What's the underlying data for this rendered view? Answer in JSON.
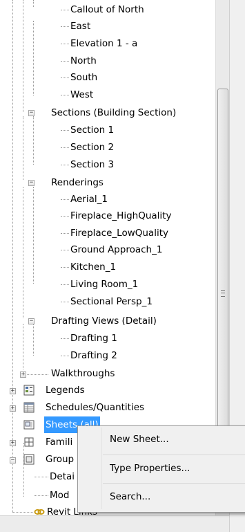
{
  "browser": {
    "items": [
      {
        "label": "Callout of North",
        "type": "leaf"
      },
      {
        "label": "East",
        "type": "leaf"
      },
      {
        "label": "Elevation 1 - a",
        "type": "leaf"
      },
      {
        "label": "North",
        "type": "leaf"
      },
      {
        "label": "South",
        "type": "leaf"
      },
      {
        "label": "West",
        "type": "leaf"
      },
      {
        "label": "Sections (Building Section)",
        "type": "group",
        "expanded": true
      },
      {
        "label": "Section 1",
        "type": "leaf"
      },
      {
        "label": "Section 2",
        "type": "leaf"
      },
      {
        "label": "Section 3",
        "type": "leaf"
      },
      {
        "label": "Renderings",
        "type": "group",
        "expanded": true
      },
      {
        "label": "Aerial_1",
        "type": "leaf"
      },
      {
        "label": "Fireplace_HighQuality",
        "type": "leaf"
      },
      {
        "label": "Fireplace_LowQuality",
        "type": "leaf"
      },
      {
        "label": "Ground Approach_1",
        "type": "leaf"
      },
      {
        "label": "Kitchen_1",
        "type": "leaf"
      },
      {
        "label": "Living Room_1",
        "type": "leaf"
      },
      {
        "label": "Sectional Persp_1",
        "type": "leaf"
      },
      {
        "label": "Drafting Views (Detail)",
        "type": "group",
        "expanded": true
      },
      {
        "label": "Drafting 1",
        "type": "leaf"
      },
      {
        "label": "Drafting 2",
        "type": "leaf"
      },
      {
        "label": "Walkthroughs",
        "type": "group",
        "expanded": false
      },
      {
        "label": "Legends",
        "type": "root",
        "icon": "legends-icon",
        "expanded": false
      },
      {
        "label": "Schedules/Quantities",
        "type": "root",
        "icon": "schedule-icon",
        "expanded": false
      },
      {
        "label": "Sheets (all)",
        "type": "root",
        "icon": "sheet-icon",
        "selected": true
      },
      {
        "label": "Famili",
        "type": "root",
        "icon": "family-icon",
        "expanded": false
      },
      {
        "label": "Group",
        "type": "root",
        "icon": "group-icon",
        "expanded": true
      },
      {
        "label": "Detai",
        "type": "leaf"
      },
      {
        "label": "Mod",
        "type": "leaf"
      },
      {
        "label": "Revit Links",
        "type": "root",
        "icon": "link-icon"
      }
    ]
  },
  "context_menu": {
    "new_sheet": "New Sheet...",
    "type_properties": "Type Properties...",
    "search": "Search..."
  },
  "colors": {
    "selection": "#3399ff",
    "tree_line": "#9a9a9a"
  }
}
